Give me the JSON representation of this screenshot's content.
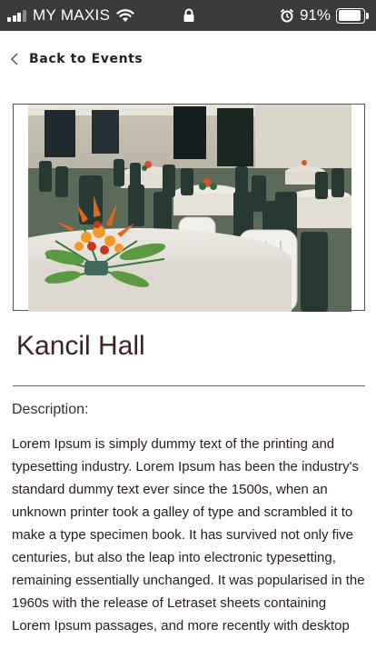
{
  "status_bar": {
    "carrier": "MY MAXIS",
    "battery_percent": "91%",
    "battery_level": 0.91,
    "icons": [
      "signal-icon",
      "wifi-icon",
      "lock-icon",
      "alarm-icon",
      "battery-icon"
    ]
  },
  "nav": {
    "back_label": "Back to Events",
    "back_icon": "chevron-left-icon"
  },
  "event": {
    "title": "Kancil Hall",
    "description_label": "Description:",
    "description": "Lorem Ipsum is simply dummy text of the printing and typesetting industry. Lorem Ipsum has been the industry's standard dummy text ever since the 1500s, when an unknown printer took a galley of type and scrambled it to make a type specimen book. It has survived not only five centuries, but also the leap into electronic typesetting, remaining essentially unchanged. It was popularised in the 1960s with the release of Letraset sheets containing Lorem Ipsum passages, and more recently with desktop"
  }
}
